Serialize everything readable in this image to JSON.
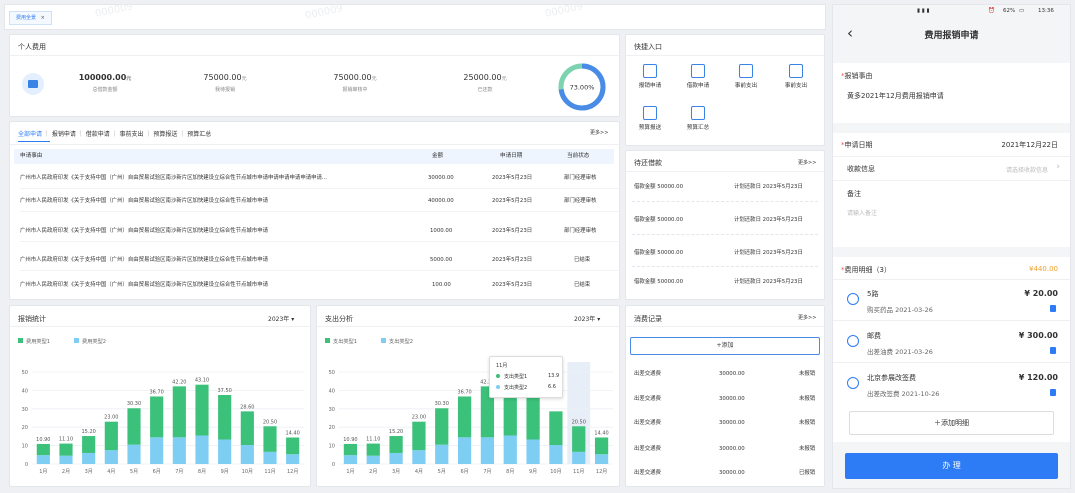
{
  "tab": {
    "label": "费用全景",
    "close": "×"
  },
  "watermarks": [
    "000009",
    "000009",
    "000009",
    "000009"
  ],
  "personal": {
    "title": "个人费用",
    "stats": [
      {
        "value": "100000.00",
        "unit": "元",
        "label": "总借款金额"
      },
      {
        "value": "75000.00",
        "unit": "元",
        "label": "我待报销"
      },
      {
        "value": "75000.00",
        "unit": "元",
        "label": "报销审核中"
      },
      {
        "value": "25000.00",
        "unit": "元",
        "label": "已还款"
      }
    ],
    "ring": {
      "label": "73.00%",
      "percent": 73
    }
  },
  "quick": {
    "title": "快捷入口",
    "items": [
      "报销申请",
      "借款申请",
      "事前支出",
      "事前支出",
      "预算报送",
      "预算汇总"
    ]
  },
  "apps": {
    "tabs": [
      "全部申请",
      "报销申请",
      "借款申请",
      "事前支出",
      "预算报送",
      "预算汇总"
    ],
    "more": "更多>>",
    "headers": [
      "申请事由",
      "金额",
      "申请日期",
      "当前状态"
    ],
    "rows": [
      {
        "reason": "广州市人民政府印发《关于支持中国（广州）自由贸易试验区南沙新片区加快建设立综合性节点城市申请申请申请申请申请申请...",
        "amount": "30000.00",
        "date": "2023年5月23日",
        "status": "部门经理审核"
      },
      {
        "reason": "广州市人民政府印发《关于支持中国（广州）自由贸易试验区南沙新片区加快建设立综合性节点城市申请",
        "amount": "40000.00",
        "date": "2023年5月23日",
        "status": "部门经理审核"
      },
      {
        "reason": "广州市人民政府印发《关于支持中国（广州）自由贸易试验区南沙新片区加快建设立综合性节点城市申请",
        "amount": "1000.00",
        "date": "2023年5月23日",
        "status": "部门经理审核"
      },
      {
        "reason": "广州市人民政府印发《关于支持中国（广州）自由贸易试验区南沙新片区加快建设立综合性节点城市申请",
        "amount": "5000.00",
        "date": "2023年5月23日",
        "status": "已结束"
      },
      {
        "reason": "广州市人民政府印发《关于支持中国（广州）自由贸易试验区南沙新片区加快建设立综合性节点城市申请",
        "amount": "100.00",
        "date": "2023年5月23日",
        "status": "已结束"
      }
    ]
  },
  "repay": {
    "title": "待还借款",
    "more": "更多>>",
    "rows": [
      {
        "amount": "借款金额 50000.00",
        "due": "计划还款日 2023年5月23日"
      },
      {
        "amount": "借款金额 50000.00",
        "due": "计划还款日 2023年5月23日"
      },
      {
        "amount": "借款金额 50000.00",
        "due": "计划还款日 2023年5月23日"
      },
      {
        "amount": "借款金额 50000.00",
        "due": "计划还款日 2023年5月23日"
      }
    ]
  },
  "charts_meta": {
    "left": {
      "title": "报销统计",
      "year": "2023年"
    },
    "right": {
      "title": "支出分析",
      "year": "2023年"
    },
    "tooltip": {
      "month": "11月",
      "row1_label": "支出类型1",
      "row1_value": "13.9",
      "row2_label": "支出类型2",
      "row2_value": "6.6"
    }
  },
  "chart_data": [
    {
      "type": "bar",
      "title": "报销统计",
      "categories": [
        "1月",
        "2月",
        "3月",
        "4月",
        "5月",
        "6月",
        "7月",
        "8月",
        "9月",
        "10月",
        "11月",
        "12月"
      ],
      "series": [
        {
          "name": "费用类型1",
          "values": [
            6.1,
            6.6,
            9.2,
            15.5,
            19.8,
            22.2,
            27.7,
            27.6,
            24.2,
            18.3,
            13.9,
            9.1
          ]
        },
        {
          "name": "费用类型2",
          "values": [
            4.8,
            4.5,
            6.0,
            7.5,
            10.5,
            14.5,
            14.5,
            15.5,
            13.3,
            10.3,
            6.6,
            5.3
          ]
        }
      ],
      "totals": [
        "10.90",
        "11.10",
        "15.20",
        "23.00",
        "30.30",
        "36.70",
        "42.20",
        "43.10",
        "37.50",
        "28.60",
        "20.50",
        "14.40"
      ],
      "ylim": [
        0,
        50
      ],
      "yticks": [
        0,
        10,
        20,
        30,
        40,
        50
      ],
      "colors": [
        "#3cc17a",
        "#7ecef4"
      ],
      "legend": "top-left",
      "grid": true
    },
    {
      "type": "bar",
      "title": "支出分析",
      "categories": [
        "1月",
        "2月",
        "3月",
        "4月",
        "5月",
        "6月",
        "7月",
        "8月",
        "9月",
        "10月",
        "11月",
        "12月"
      ],
      "series": [
        {
          "name": "支出类型1",
          "values": [
            6.1,
            6.6,
            9.2,
            15.5,
            19.8,
            22.2,
            27.7,
            27.6,
            24.2,
            18.3,
            13.9,
            9.1
          ]
        },
        {
          "name": "支出类型2",
          "values": [
            4.8,
            4.5,
            6.0,
            7.5,
            10.5,
            14.5,
            14.5,
            15.5,
            13.3,
            10.3,
            6.6,
            5.3
          ]
        }
      ],
      "totals": [
        "10.90",
        "11.10",
        "15.20",
        "23.00",
        "30.30",
        "36.70",
        "42.20",
        "",
        "",
        "",
        "20.50",
        "14.40"
      ],
      "ylim": [
        0,
        50
      ],
      "yticks": [
        0,
        10,
        20,
        30,
        40,
        50
      ],
      "colors": [
        "#3cc17a",
        "#7ecef4"
      ],
      "highlight": "11月",
      "legend": "top-left",
      "grid": true
    }
  ],
  "consume": {
    "title": "消费记录",
    "more": "更多>>",
    "add": "+添加",
    "rows": [
      {
        "type": "出差交通费",
        "amount": "30000.00",
        "status": "未报销"
      },
      {
        "type": "出差交通费",
        "amount": "30000.00",
        "status": "未报销"
      },
      {
        "type": "出差交通费",
        "amount": "30000.00",
        "status": "未报销"
      },
      {
        "type": "出差交通费",
        "amount": "30000.00",
        "status": "未报销"
      },
      {
        "type": "出差交通费",
        "amount": "30000.00",
        "status": "已报销"
      }
    ]
  },
  "mobile": {
    "status_time": "13:36",
    "status_battery": "62%",
    "header_title": "费用报销申请",
    "back": "‹",
    "reason_label": "报销事由",
    "reason_value": "黄多2021年12月费用报销申请",
    "date_label": "申请日期",
    "date_value": "2021年12月22日",
    "payee_label": "收款信息",
    "payee_placeholder": "请选择收款信息",
    "note_label": "备注",
    "note_placeholder": "请输入备注",
    "detail_label": "费用明细（3）",
    "detail_total": "¥440.00",
    "details": [
      {
        "title": "5路",
        "sub": "购买药品 2021-03-26",
        "amount": "¥ 20.00"
      },
      {
        "title": "邮费",
        "sub": "出差油费 2021-03-26",
        "amount": "¥ 300.00"
      },
      {
        "title": "北京参展改签费",
        "sub": "出差改签费 2021-10-26",
        "amount": "¥ 120.00"
      }
    ],
    "add_detail": "＋添加明细",
    "submit": "办 理"
  }
}
